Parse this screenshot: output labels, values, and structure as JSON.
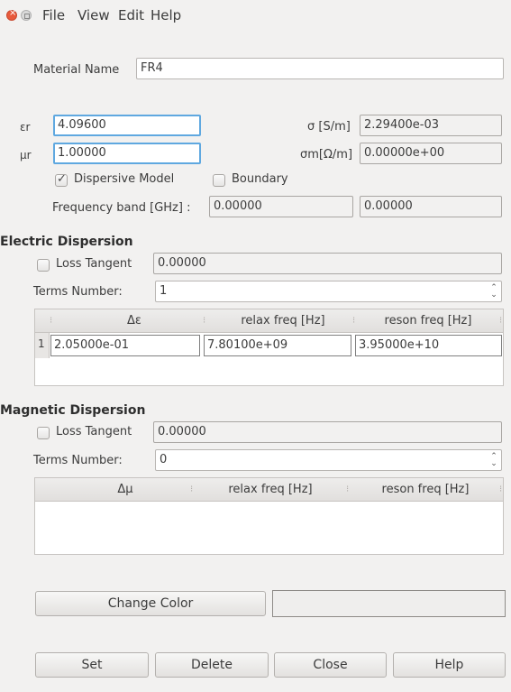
{
  "menu": {
    "items": [
      "File",
      "View",
      "Edit",
      "Help"
    ]
  },
  "material": {
    "name_label": "Material Name",
    "name_value": "FR4"
  },
  "properties": {
    "eps_label": "εr",
    "eps_value": "4.09600",
    "mu_label": "μr",
    "mu_value": "1.00000",
    "sigma_label": "σ [S/m]",
    "sigma_value": "2.29400e-03",
    "sigma_m_label": "σm[Ω/m]",
    "sigma_m_value": "0.00000e+00"
  },
  "options": {
    "dispersive_label": "Dispersive Model",
    "dispersive_checked": true,
    "boundary_label": "Boundary",
    "boundary_checked": false,
    "freq_band_label": "Frequency band [GHz] :",
    "freq_low": "0.00000",
    "freq_high": "0.00000"
  },
  "electric": {
    "title": "Electric Dispersion",
    "loss_tangent_label": "Loss Tangent",
    "loss_tangent_value": "0.00000",
    "terms_label": "Terms Number:",
    "terms_value": "1",
    "columns": [
      "Δε",
      "relax freq [Hz]",
      "reson freq [Hz]"
    ],
    "rows": [
      {
        "index": "1",
        "cells": [
          "2.05000e-01",
          "7.80100e+09",
          "3.95000e+10"
        ]
      }
    ]
  },
  "magnetic": {
    "title": "Magnetic Dispersion",
    "loss_tangent_label": "Loss Tangent",
    "loss_tangent_value": "0.00000",
    "terms_label": "Terms Number:",
    "terms_value": "0",
    "columns": [
      "Δμ",
      "relax freq [Hz]",
      "reson freq [Hz]"
    ]
  },
  "buttons": {
    "change_color": "Change Color",
    "set": "Set",
    "delete": "Delete",
    "close": "Close",
    "help": "Help"
  }
}
